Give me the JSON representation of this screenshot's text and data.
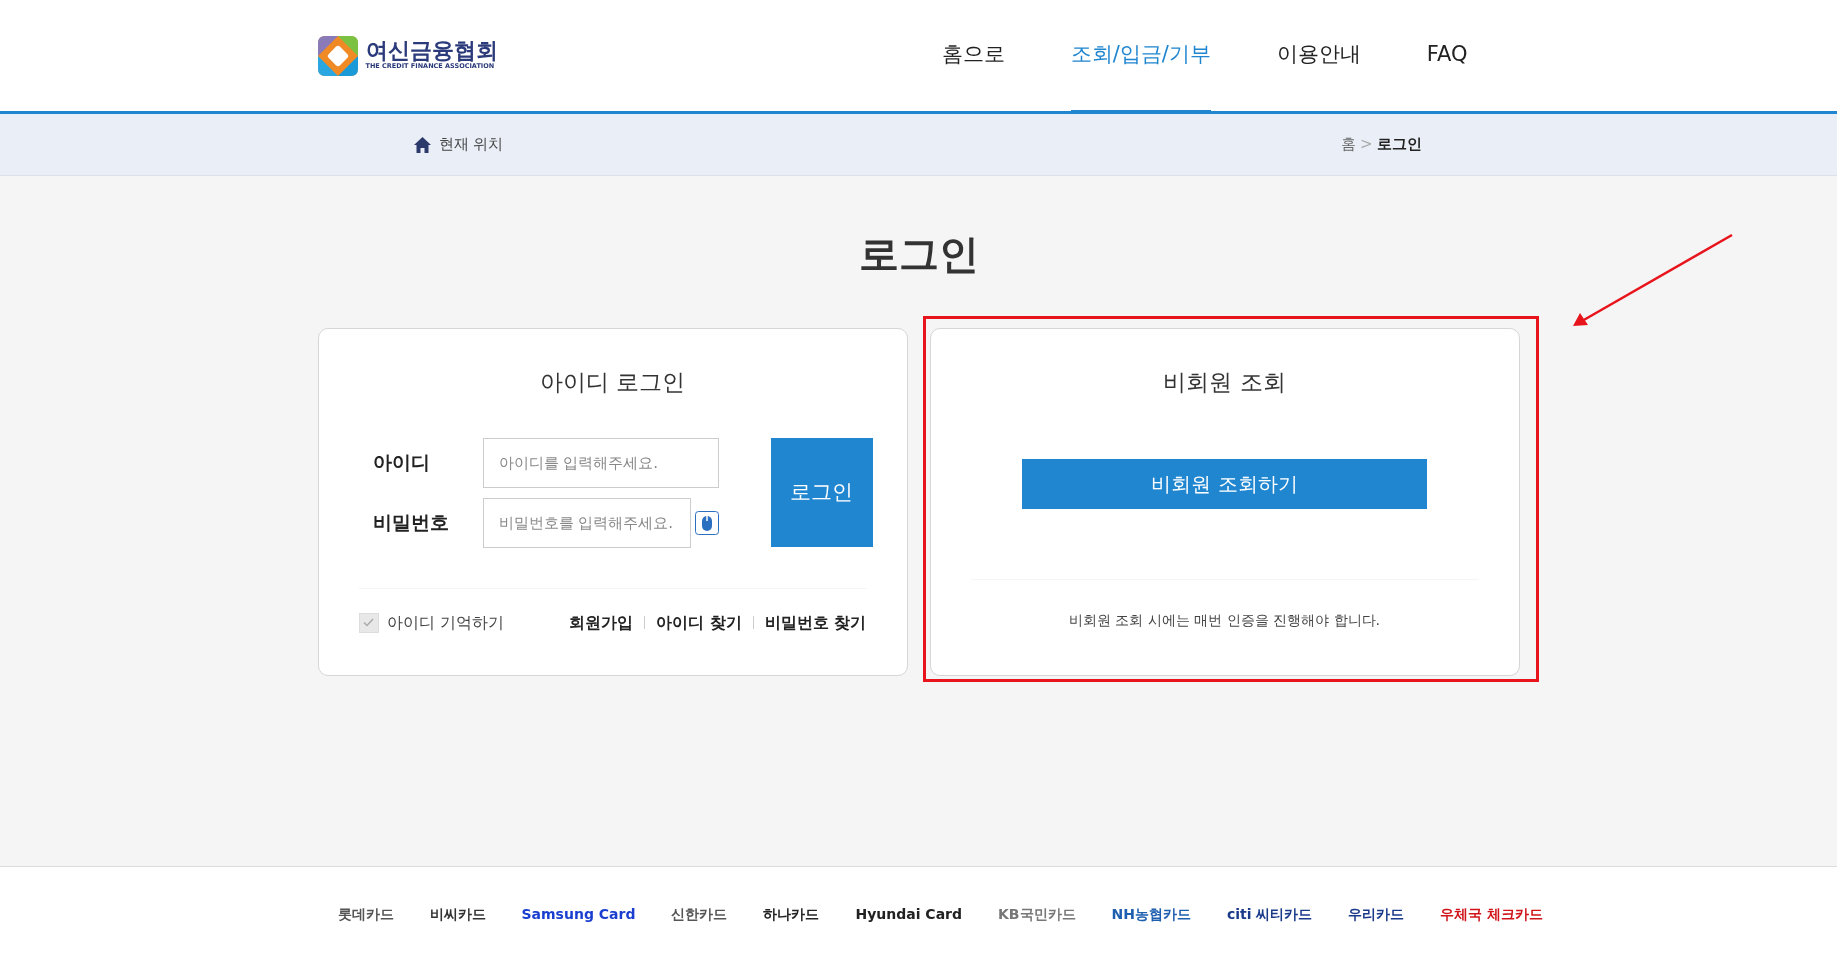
{
  "header": {
    "logo": {
      "name": "여신금융협회",
      "tagline": "THE CREDIT FINANCE ASSOCIATION"
    },
    "nav": [
      {
        "label": "홈으로",
        "selected": false
      },
      {
        "label": "조회/입금/기부",
        "selected": true
      },
      {
        "label": "이용안내",
        "selected": false
      },
      {
        "label": "FAQ",
        "selected": false
      }
    ]
  },
  "breadcrumb": {
    "label": "현재 위치",
    "path": [
      "홈",
      "로그인"
    ],
    "separator": ">"
  },
  "page_title": "로그인",
  "login_card": {
    "title": "아이디 로그인",
    "fields": [
      {
        "label": "아이디",
        "placeholder": "아이디를 입력해주세요.",
        "keypad": false
      },
      {
        "label": "비밀번호",
        "placeholder": "비밀번호를 입력해주세요.",
        "keypad": true
      }
    ],
    "submit": "로그인",
    "remember": {
      "label": "아이디 기억하기",
      "checked": true
    },
    "links": [
      "회원가입",
      "아이디 찾기",
      "비밀번호 찾기"
    ]
  },
  "guest_card": {
    "title": "비회원 조회",
    "button": "비회원 조회하기",
    "notice": "비회원 조회 시에는 매번 인증을 진행해야 합니다."
  },
  "annotations": {
    "highlight_box": true,
    "arrow": true
  },
  "footer": {
    "card_brands": [
      {
        "name": "롯데카드",
        "color": "#555555"
      },
      {
        "name": "비씨카드",
        "color": "#333333"
      },
      {
        "name": "Samsung Card",
        "color": "#1a3fd0"
      },
      {
        "name": "신한카드",
        "color": "#555555"
      },
      {
        "name": "하나카드",
        "color": "#222222"
      },
      {
        "name": "Hyundai Card",
        "color": "#222222"
      },
      {
        "name": "KB국민카드",
        "color": "#777777"
      },
      {
        "name": "NH농협카드",
        "color": "#1f5fb0"
      },
      {
        "name": "citi 씨티카드",
        "color": "#1a3a8a"
      },
      {
        "name": "우리카드",
        "color": "#1a3a8a"
      },
      {
        "name": "우체국 체크카드",
        "color": "#d0141a"
      }
    ]
  }
}
